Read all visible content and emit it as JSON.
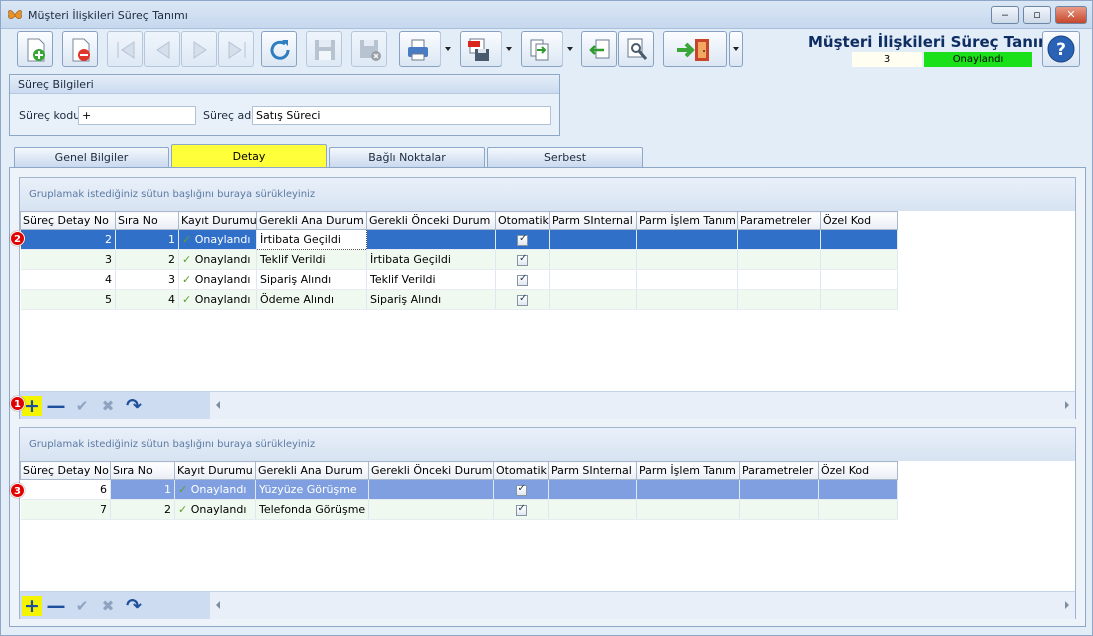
{
  "window": {
    "title": "Müşteri İlişkileri Süreç Tanımı",
    "controls": [
      "minimize",
      "maximize",
      "close"
    ]
  },
  "toolbar": {
    "buttons": [
      {
        "name": "new-icon",
        "state": "enabled"
      },
      {
        "name": "delete-icon",
        "state": "enabled"
      },
      {
        "name": "first-record-icon",
        "state": "disabled"
      },
      {
        "name": "previous-record-icon",
        "state": "disabled"
      },
      {
        "name": "next-record-icon",
        "state": "disabled"
      },
      {
        "name": "last-record-icon",
        "state": "disabled"
      },
      {
        "name": "refresh-icon",
        "state": "enabled"
      },
      {
        "name": "save-icon",
        "state": "disabled"
      },
      {
        "name": "save-cancel-icon",
        "state": "disabled"
      },
      {
        "name": "print-icon",
        "state": "enabled"
      },
      {
        "name": "pdf-export-icon",
        "state": "enabled"
      },
      {
        "name": "transfer-icon",
        "state": "enabled"
      },
      {
        "name": "import-icon",
        "state": "enabled"
      },
      {
        "name": "search-document-icon",
        "state": "enabled"
      },
      {
        "name": "exit-icon",
        "state": "enabled"
      }
    ]
  },
  "header": {
    "form_title": "Müşteri İlişkileri Süreç Tanımı",
    "record_number": "3",
    "status": "Onaylandı",
    "status_color": "#19e019"
  },
  "process_info": {
    "group_title": "Süreç Bilgileri",
    "code_label": "Süreç kodu",
    "code_value": "+",
    "name_label": "Süreç adı",
    "name_value": "Satış Süreci"
  },
  "tabs": [
    {
      "label": "Genel Bilgiler",
      "active": false
    },
    {
      "label": "Detay",
      "active": true
    },
    {
      "label": "Bağlı Noktalar",
      "active": false
    },
    {
      "label": "Serbest",
      "active": false
    }
  ],
  "grid_top": {
    "group_hint": "Gruplamak istediğiniz sütun başlığını buraya sürükleyiniz",
    "columns": [
      "Süreç Detay No",
      "Sıra No",
      "Kayıt Durumu",
      "Gerekli Ana Durum",
      "Gerekli Önceki Durum",
      "Otomatik",
      "Parm SInternal",
      "Parm İşlem Tanım No",
      "Parametreler",
      "Özel Kod"
    ],
    "rows": [
      {
        "detail_no": "2",
        "order": "1",
        "status": "Onaylandı",
        "main": "İrtibata Geçildi",
        "prev": "",
        "auto": true
      },
      {
        "detail_no": "3",
        "order": "2",
        "status": "Onaylandı",
        "main": "Teklif Verildi",
        "prev": "İrtibata Geçildi",
        "auto": true
      },
      {
        "detail_no": "4",
        "order": "3",
        "status": "Onaylandı",
        "main": "Sipariş Alındı",
        "prev": "Teklif Verildi",
        "auto": true
      },
      {
        "detail_no": "5",
        "order": "4",
        "status": "Onaylandı",
        "main": "Ödeme Alındı",
        "prev": "Sipariş Alındı",
        "auto": true
      }
    ]
  },
  "grid_bottom": {
    "group_hint": "Gruplamak istediğiniz sütun başlığını buraya sürükleyiniz",
    "columns": [
      "Süreç Detay No",
      "Sıra No",
      "Kayıt Durumu",
      "Gerekli Ana Durum",
      "Gerekli Önceki Durum",
      "Otomatik",
      "Parm SInternal",
      "Parm İşlem Tanım No",
      "Parametreler",
      "Özel Kod"
    ],
    "rows": [
      {
        "detail_no": "6",
        "order": "1",
        "status": "Onaylandı",
        "main": "Yüzyüze Görüşme",
        "prev": "",
        "auto": true
      },
      {
        "detail_no": "7",
        "order": "2",
        "status": "Onaylandı",
        "main": "Telefonda Görüşme",
        "prev": "",
        "auto": true
      }
    ]
  },
  "navigator": {
    "icons": [
      "add-icon",
      "remove-icon",
      "confirm-icon",
      "cancel-icon",
      "redo-icon"
    ],
    "add_symbol": "+",
    "remove_symbol": "—",
    "confirm_symbol": "✔",
    "cancel_symbol": "✖",
    "redo_symbol": "↷"
  },
  "badges": {
    "one": "1",
    "two": "2",
    "three": "3",
    "color": "#e00000"
  },
  "tick_symbol": "✓"
}
